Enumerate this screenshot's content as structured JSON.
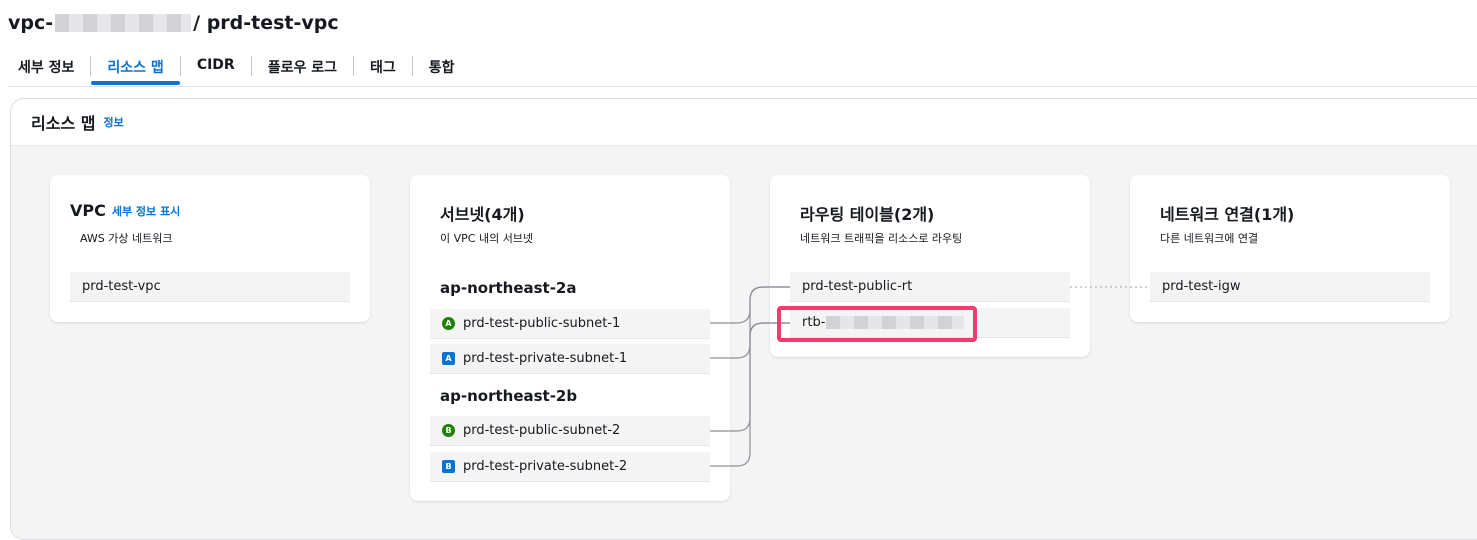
{
  "page": {
    "title_prefix": "vpc-",
    "title_suffix": "/ prd-test-vpc"
  },
  "tabs": [
    {
      "label": "세부 정보",
      "active": false
    },
    {
      "label": "리소스 맵",
      "active": true
    },
    {
      "label": "CIDR",
      "active": false
    },
    {
      "label": "플로우 로그",
      "active": false
    },
    {
      "label": "태그",
      "active": false
    },
    {
      "label": "통합",
      "active": false
    }
  ],
  "resource_map": {
    "title": "리소스 맵",
    "info_label": "정보"
  },
  "vpc_card": {
    "title": "VPC",
    "details_link": "세부 정보 표시",
    "subtitle": "AWS 가상 네트워크",
    "items": [
      "prd-test-vpc"
    ]
  },
  "subnets_card": {
    "title": "서브넷(4개)",
    "subtitle": "이 VPC 내의 서브넷",
    "zones": [
      {
        "name": "ap-northeast-2a",
        "subnets": [
          {
            "icon": "public-subnet-icon",
            "letter": "A",
            "name": "prd-test-public-subnet-1"
          },
          {
            "icon": "private-subnet-icon",
            "letter": "A",
            "name": "prd-test-private-subnet-1"
          }
        ]
      },
      {
        "name": "ap-northeast-2b",
        "subnets": [
          {
            "icon": "public-subnet-icon",
            "letter": "B",
            "name": "prd-test-public-subnet-2"
          },
          {
            "icon": "private-subnet-icon",
            "letter": "B",
            "name": "prd-test-private-subnet-2"
          }
        ]
      }
    ]
  },
  "route_tables_card": {
    "title": "라우팅 테이블(2개)",
    "subtitle": "네트워크 트래픽을 리소스로 라우팅",
    "items": [
      "prd-test-public-rt",
      "rtb-"
    ]
  },
  "network_card": {
    "title": "네트워크 연결(1개)",
    "subtitle": "다른 네트워크에 연결",
    "items": [
      "prd-test-igw"
    ]
  },
  "colors": {
    "accent": "#0972d3",
    "public_subnet": "#1d8102",
    "private_subnet": "#0972d3",
    "highlight": "#f63a6d",
    "connector": "#8d8d99"
  }
}
